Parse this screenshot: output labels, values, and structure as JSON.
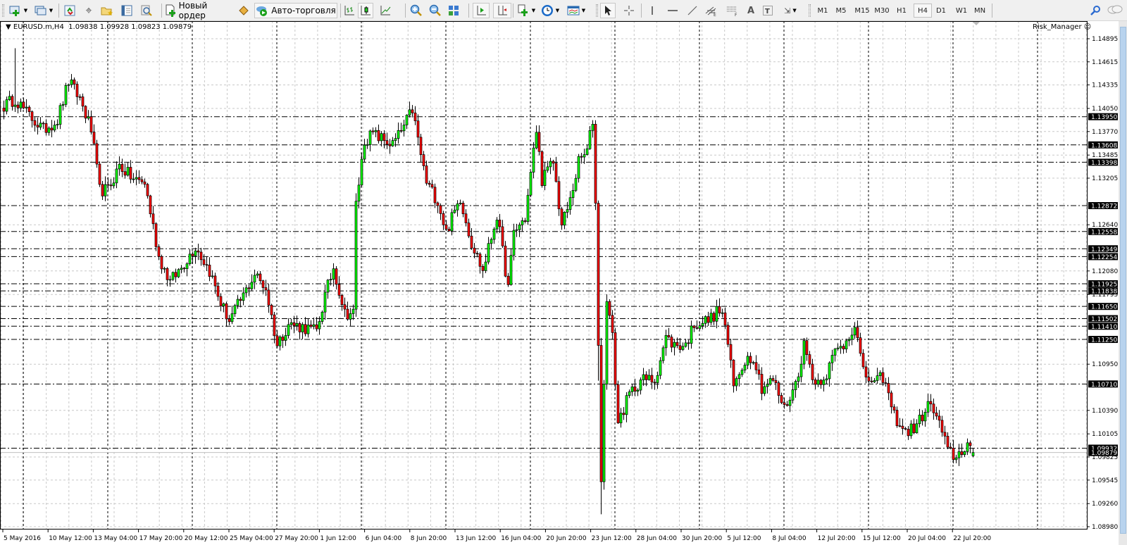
{
  "toolbar": {
    "new_order_label": "Новый ордер",
    "autotrading_label": "Авто-торговля",
    "timeframes": [
      "M1",
      "M5",
      "M15",
      "M30",
      "H1",
      "H4",
      "D1",
      "W1",
      "MN"
    ],
    "active_timeframe": "H4"
  },
  "chart": {
    "header": "EURUSD.m,H4  1.09838 1.09928 1.09823 1.09879",
    "indicator_label": "Risk_Manager",
    "bid": 1.09879,
    "bull_color": "#00ff00",
    "bear_color": "#ff0000",
    "price_axis": [
      "1.14895",
      "1.14615",
      "1.14335",
      "1.14050",
      "1.13770",
      "1.13485",
      "1.13205",
      "1.12640",
      "1.12080",
      "1.11795",
      "1.10950",
      "1.10390",
      "1.10105",
      "1.09825",
      "1.09545",
      "1.09260",
      "1.08980"
    ],
    "levels": [
      "1.13950",
      "1.13608",
      "1.13398",
      "1.12872",
      "1.12558",
      "1.12349",
      "1.12254",
      "1.11925",
      "1.11838",
      "1.11650",
      "1.11502",
      "1.11410",
      "1.11250",
      "1.10710",
      "1.09932"
    ],
    "bid_label": "1.09879",
    "time_axis": [
      "5 May 2016",
      "10 May 12:00",
      "13 May 04:00",
      "17 May 20:00",
      "20 May 12:00",
      "25 May 04:00",
      "27 May 20:00",
      "1 Jun 12:00",
      "6 Jun 04:00",
      "8 Jun 20:00",
      "13 Jun 12:00",
      "16 Jun 04:00",
      "20 Jun 20:00",
      "23 Jun 12:00",
      "28 Jun 04:00",
      "30 Jun 20:00",
      "5 Jul 12:00",
      "8 Jul 04:00",
      "12 Jul 20:00",
      "15 Jul 12:00",
      "20 Jul 04:00",
      "22 Jul 20:00"
    ],
    "bar_count": 345,
    "close_path": [
      [
        0,
        1.1408
      ],
      [
        4,
        1.1417
      ],
      [
        8,
        1.14
      ],
      [
        14,
        1.1379
      ],
      [
        19,
        1.1391
      ],
      [
        23,
        1.1438
      ],
      [
        27,
        1.1417
      ],
      [
        31,
        1.1379
      ],
      [
        34,
        1.1306
      ],
      [
        37,
        1.1306
      ],
      [
        41,
        1.1336
      ],
      [
        46,
        1.1319
      ],
      [
        50,
        1.1315
      ],
      [
        52,
        1.128
      ],
      [
        55,
        1.1225
      ],
      [
        59,
        1.1195
      ],
      [
        63,
        1.1212
      ],
      [
        68,
        1.1238
      ],
      [
        73,
        1.1208
      ],
      [
        77,
        1.1169
      ],
      [
        80,
        1.1148
      ],
      [
        85,
        1.1178
      ],
      [
        89,
        1.1204
      ],
      [
        93,
        1.1187
      ],
      [
        97,
        1.1118
      ],
      [
        101,
        1.1144
      ],
      [
        106,
        1.114
      ],
      [
        111,
        1.1135
      ],
      [
        114,
        1.1178
      ],
      [
        117,
        1.1212
      ],
      [
        121,
        1.1157
      ],
      [
        124,
        1.1157
      ],
      [
        125,
        1.1289
      ],
      [
        128,
        1.1366
      ],
      [
        131,
        1.1374
      ],
      [
        138,
        1.1361
      ],
      [
        142,
        1.1383
      ],
      [
        145,
        1.1404
      ],
      [
        148,
        1.1349
      ],
      [
        150,
        1.1315
      ],
      [
        154,
        1.1293
      ],
      [
        157,
        1.1255
      ],
      [
        162,
        1.1297
      ],
      [
        166,
        1.1242
      ],
      [
        170,
        1.1208
      ],
      [
        175,
        1.1276
      ],
      [
        179,
        1.1187
      ],
      [
        181,
        1.1255
      ],
      [
        185,
        1.1272
      ],
      [
        189,
        1.1379
      ],
      [
        191,
        1.1319
      ],
      [
        195,
        1.134
      ],
      [
        198,
        1.1263
      ],
      [
        201,
        1.1293
      ],
      [
        204,
        1.134
      ],
      [
        207,
        1.1353
      ],
      [
        209,
        1.1391
      ],
      [
        210,
        1.1289
      ],
      [
        212,
        1.0956
      ],
      [
        214,
        1.1178
      ],
      [
        216,
        1.1127
      ],
      [
        218,
        1.1024
      ],
      [
        222,
        1.1058
      ],
      [
        226,
        1.1076
      ],
      [
        231,
        1.1076
      ],
      [
        235,
        1.1127
      ],
      [
        238,
        1.1118
      ],
      [
        242,
        1.1118
      ],
      [
        245,
        1.1144
      ],
      [
        250,
        1.1148
      ],
      [
        254,
        1.1161
      ],
      [
        256,
        1.1144
      ],
      [
        259,
        1.1067
      ],
      [
        263,
        1.1101
      ],
      [
        266,
        1.1105
      ],
      [
        269,
        1.1067
      ],
      [
        273,
        1.1076
      ],
      [
        277,
        1.1041
      ],
      [
        281,
        1.1071
      ],
      [
        284,
        1.1118
      ],
      [
        288,
        1.1071
      ],
      [
        292,
        1.1084
      ],
      [
        295,
        1.111
      ],
      [
        298,
        1.1118
      ],
      [
        302,
        1.1144
      ],
      [
        305,
        1.1084
      ],
      [
        309,
        1.1071
      ],
      [
        312,
        1.108
      ],
      [
        316,
        1.1033
      ],
      [
        320,
        1.1012
      ],
      [
        324,
        1.102
      ],
      [
        328,
        1.1046
      ],
      [
        331,
        1.1033
      ],
      [
        335,
        1.099
      ],
      [
        338,
        1.0982
      ],
      [
        342,
        1.0999
      ],
      [
        344,
        1.09879
      ]
    ]
  }
}
